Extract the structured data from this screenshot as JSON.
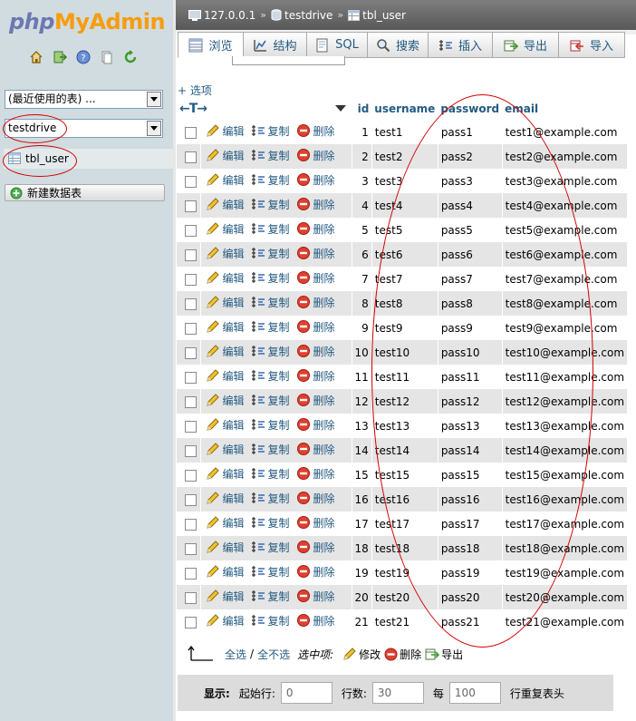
{
  "logo": {
    "php": "php",
    "myadmin": "MyAdmin"
  },
  "nav": {
    "icons": [
      "home-icon",
      "logout-icon",
      "help-icon",
      "docs-icon",
      "reload-icon"
    ],
    "recent_tables_select": "(最近使用的表) ...",
    "database_select": "testdrive",
    "tables": [
      {
        "label": "tbl_user",
        "icon": "table-icon"
      }
    ],
    "new_table_button": "新建数据表"
  },
  "breadcrumb": {
    "server": "127.0.0.1",
    "database": "testdrive",
    "table": "tbl_user"
  },
  "tabs": [
    {
      "label": "浏览",
      "icon": "browse-icon",
      "active": true
    },
    {
      "label": "结构",
      "icon": "structure-icon",
      "active": false
    },
    {
      "label": "SQL",
      "icon": "sql-icon",
      "active": false
    },
    {
      "label": "搜索",
      "icon": "search-icon",
      "active": false
    },
    {
      "label": "插入",
      "icon": "insert-icon",
      "active": false
    },
    {
      "label": "导出",
      "icon": "export-icon",
      "active": false
    },
    {
      "label": "导入",
      "icon": "import-icon",
      "active": false
    }
  ],
  "options_link": "+ 选项",
  "table": {
    "columns": [
      "id",
      "username",
      "password",
      "email"
    ],
    "actions": {
      "edit": "编辑",
      "copy": "复制",
      "delete": "删除"
    },
    "rows": [
      [
        "1",
        "test1",
        "pass1",
        "test1@example.com"
      ],
      [
        "2",
        "test2",
        "pass2",
        "test2@example.com"
      ],
      [
        "3",
        "test3",
        "pass3",
        "test3@example.com"
      ],
      [
        "4",
        "test4",
        "pass4",
        "test4@example.com"
      ],
      [
        "5",
        "test5",
        "pass5",
        "test5@example.com"
      ],
      [
        "6",
        "test6",
        "pass6",
        "test6@example.com"
      ],
      [
        "7",
        "test7",
        "pass7",
        "test7@example.com"
      ],
      [
        "8",
        "test8",
        "pass8",
        "test8@example.com"
      ],
      [
        "9",
        "test9",
        "pass9",
        "test9@example.com"
      ],
      [
        "10",
        "test10",
        "pass10",
        "test10@example.com"
      ],
      [
        "11",
        "test11",
        "pass11",
        "test11@example.com"
      ],
      [
        "12",
        "test12",
        "pass12",
        "test12@example.com"
      ],
      [
        "13",
        "test13",
        "pass13",
        "test13@example.com"
      ],
      [
        "14",
        "test14",
        "pass14",
        "test14@example.com"
      ],
      [
        "15",
        "test15",
        "pass15",
        "test15@example.com"
      ],
      [
        "16",
        "test16",
        "pass16",
        "test16@example.com"
      ],
      [
        "17",
        "test17",
        "pass17",
        "test17@example.com"
      ],
      [
        "18",
        "test18",
        "pass18",
        "test18@example.com"
      ],
      [
        "19",
        "test19",
        "pass19",
        "test19@example.com"
      ],
      [
        "20",
        "test20",
        "pass20",
        "test20@example.com"
      ],
      [
        "21",
        "test21",
        "pass21",
        "test21@example.com"
      ]
    ]
  },
  "bulk": {
    "select_all": "全选",
    "separator": "/",
    "deselect_all": "全不选",
    "with_selected": "选中项:",
    "modify": "修改",
    "delete": "删除",
    "export": "导出"
  },
  "footer": {
    "show_label": "显示:",
    "start_row_label": "起始行:",
    "start_row_value": "0",
    "rows_label": "行数:",
    "rows_value": "30",
    "per_label": "每",
    "repeat_value": "100",
    "repeat_label": "行重复表头"
  },
  "colors": {
    "link": "#235a81",
    "annotation": "#d00000",
    "nav_bg": "#d0dce0",
    "even_row": "#e5e5e5"
  }
}
